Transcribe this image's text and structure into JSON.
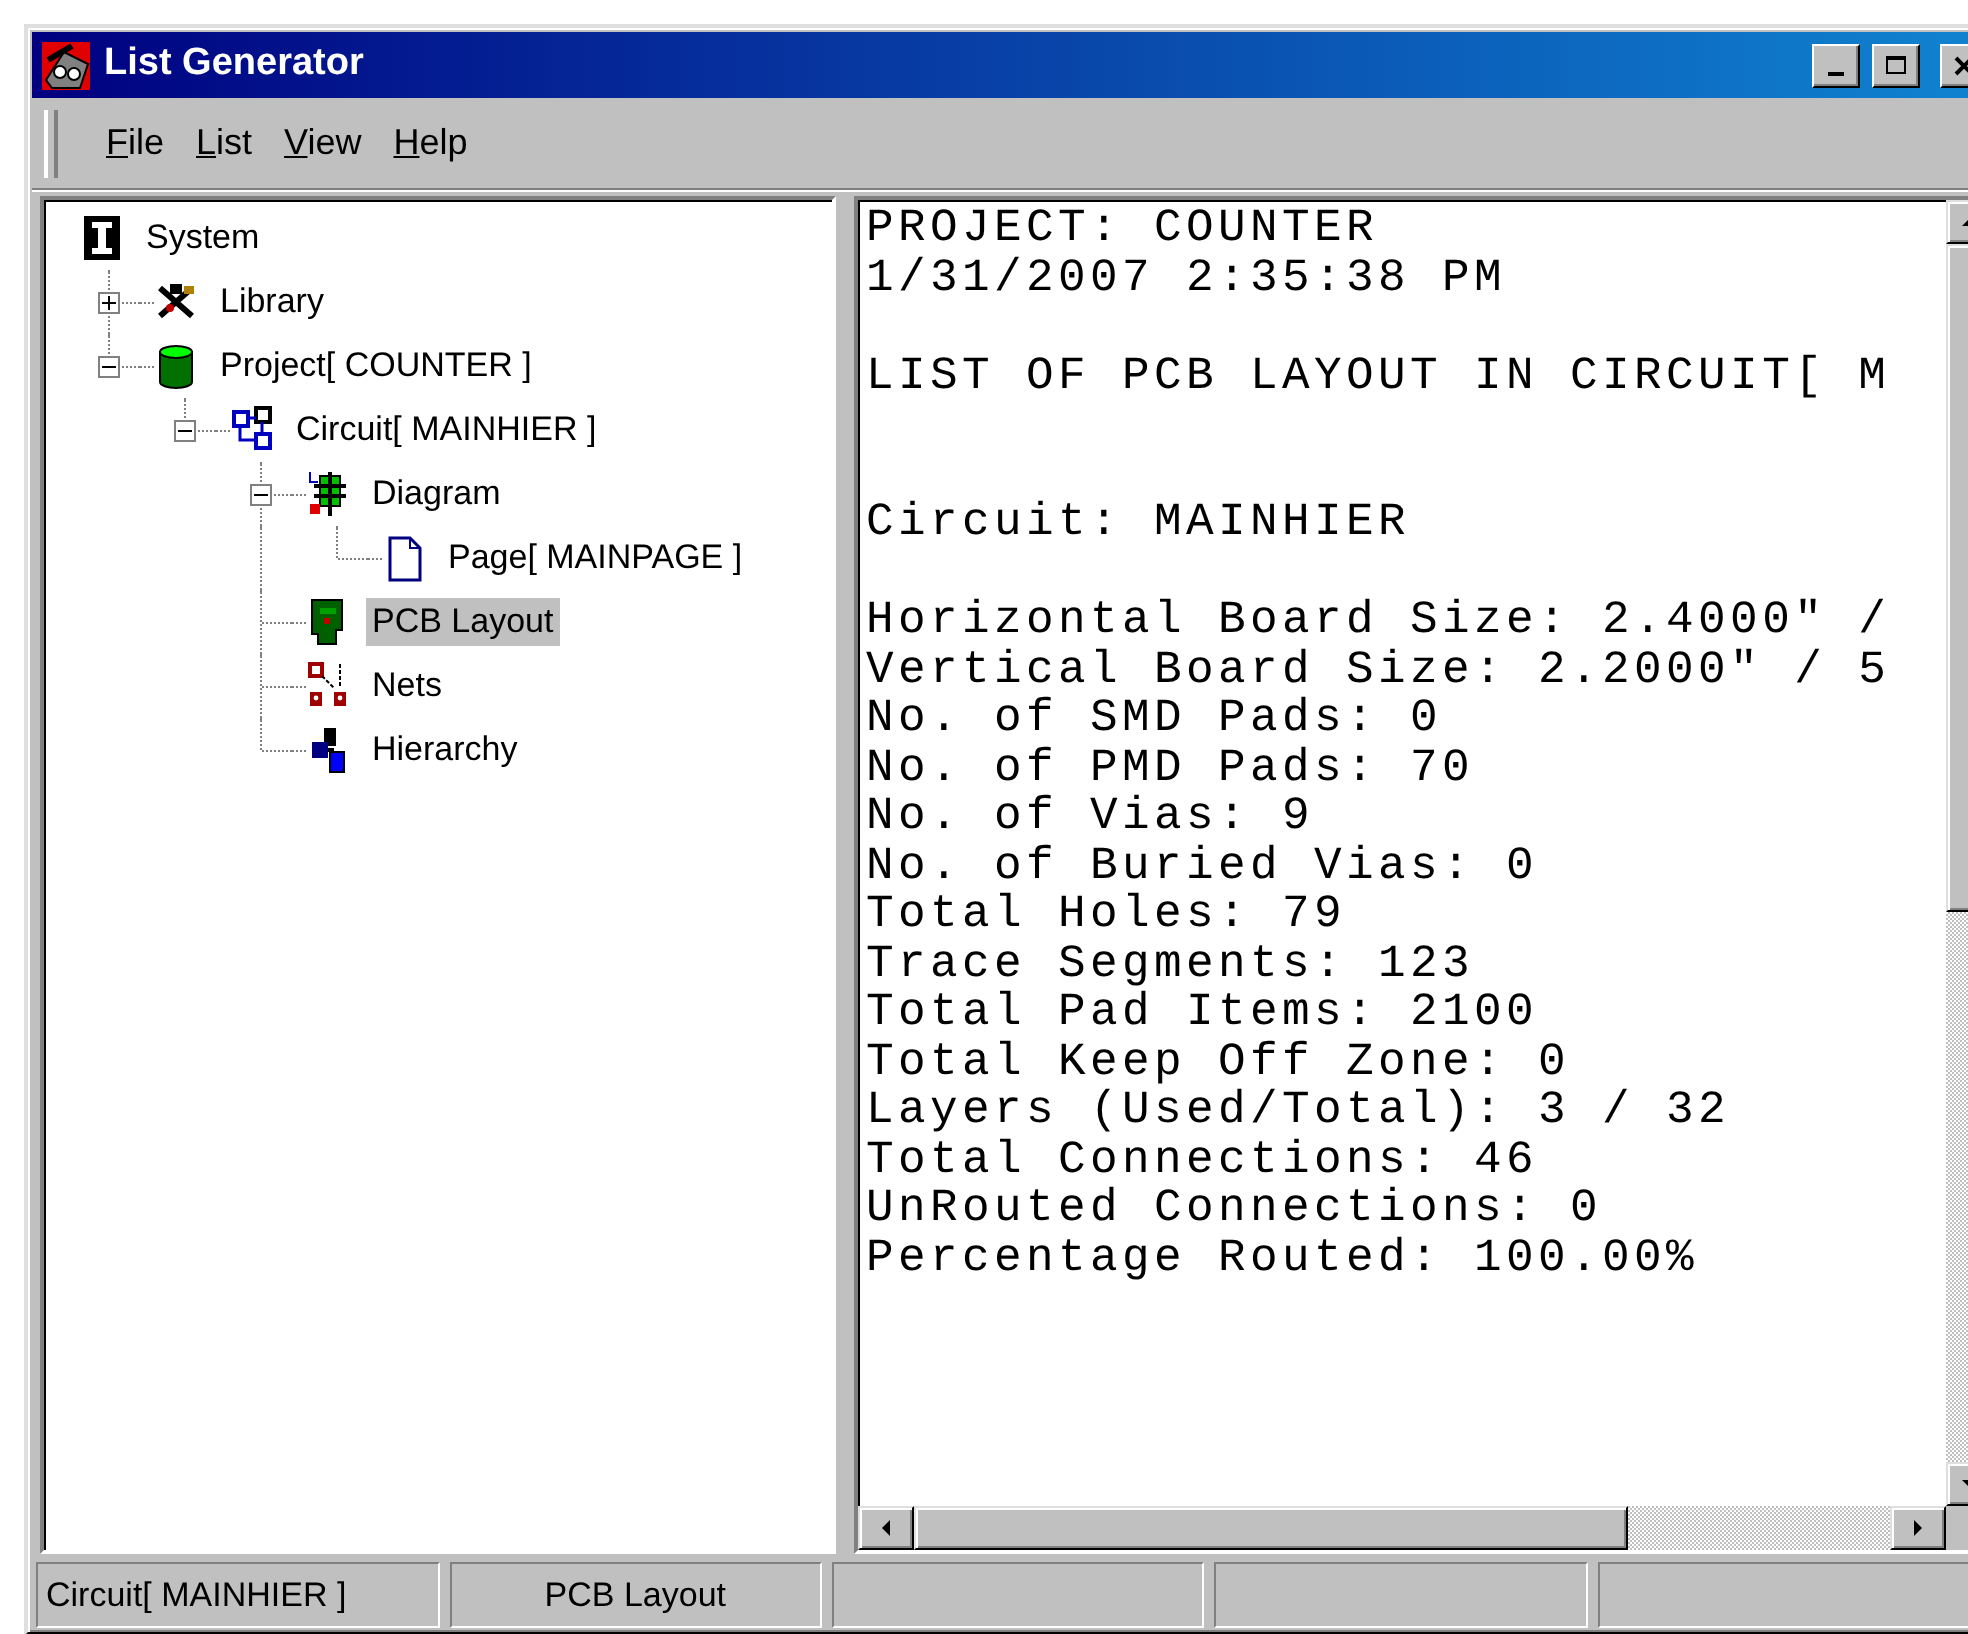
{
  "window": {
    "title": "List Generator"
  },
  "menu": [
    "File",
    "List",
    "View",
    "Help"
  ],
  "tree": [
    {
      "label": "System",
      "kind": "system",
      "selected": false,
      "children": [
        {
          "label": "Library",
          "kind": "library",
          "selected": false,
          "expanded": false
        },
        {
          "label": "Project[ COUNTER ]",
          "kind": "project",
          "selected": false,
          "expanded": true,
          "children": [
            {
              "label": "Circuit[ MAINHIER ]",
              "kind": "circuit",
              "selected": false,
              "expanded": true,
              "children": [
                {
                  "label": "Diagram",
                  "kind": "diagram",
                  "selected": false,
                  "expanded": true,
                  "children": [
                    {
                      "label": "Page[ MAINPAGE ]",
                      "kind": "page",
                      "selected": false
                    }
                  ]
                },
                {
                  "label": "PCB Layout",
                  "kind": "pcb",
                  "selected": true
                },
                {
                  "label": "Nets",
                  "kind": "nets",
                  "selected": false
                },
                {
                  "label": "Hierarchy",
                  "kind": "hierarchy",
                  "selected": false
                }
              ]
            }
          ]
        }
      ]
    }
  ],
  "report": [
    {
      "kind": "text",
      "text": "PROJECT: COUNTER"
    },
    {
      "kind": "text",
      "text": "1/31/2007 2:35:38 PM"
    },
    {
      "kind": "blank"
    },
    {
      "kind": "text",
      "text": "LIST OF PCB LAYOUT IN CIRCUIT[ M"
    },
    {
      "kind": "blank"
    },
    {
      "kind": "blank"
    },
    {
      "kind": "text",
      "text": "Circuit: MAINHIER"
    },
    {
      "kind": "blank"
    },
    {
      "kind": "text",
      "text": "Horizontal Board Size: 2.4000\" /"
    },
    {
      "kind": "text",
      "text": "Vertical Board Size: 2.2000\" / 5"
    },
    {
      "kind": "text",
      "text": "No. of SMD Pads: 0"
    },
    {
      "kind": "text",
      "text": "No. of PMD Pads: 70"
    },
    {
      "kind": "text",
      "text": "No. of Vias: 9"
    },
    {
      "kind": "text",
      "text": "No. of Buried Vias: 0"
    },
    {
      "kind": "text",
      "text": "Total Holes: 79"
    },
    {
      "kind": "text",
      "text": "Trace Segments: 123"
    },
    {
      "kind": "text",
      "text": "Total Pad Items: 2100"
    },
    {
      "kind": "text",
      "text": "Total Keep Off Zone: 0"
    },
    {
      "kind": "text",
      "text": "Layers (Used/Total): 3 / 32"
    },
    {
      "kind": "text",
      "text": "Total Connections: 46"
    },
    {
      "kind": "text",
      "text": "UnRouted Connections: 0"
    },
    {
      "kind": "text",
      "text": "Percentage Routed: 100.00%"
    }
  ],
  "status_bar": [
    "Circuit[ MAINHIER ]",
    "PCB Layout"
  ]
}
